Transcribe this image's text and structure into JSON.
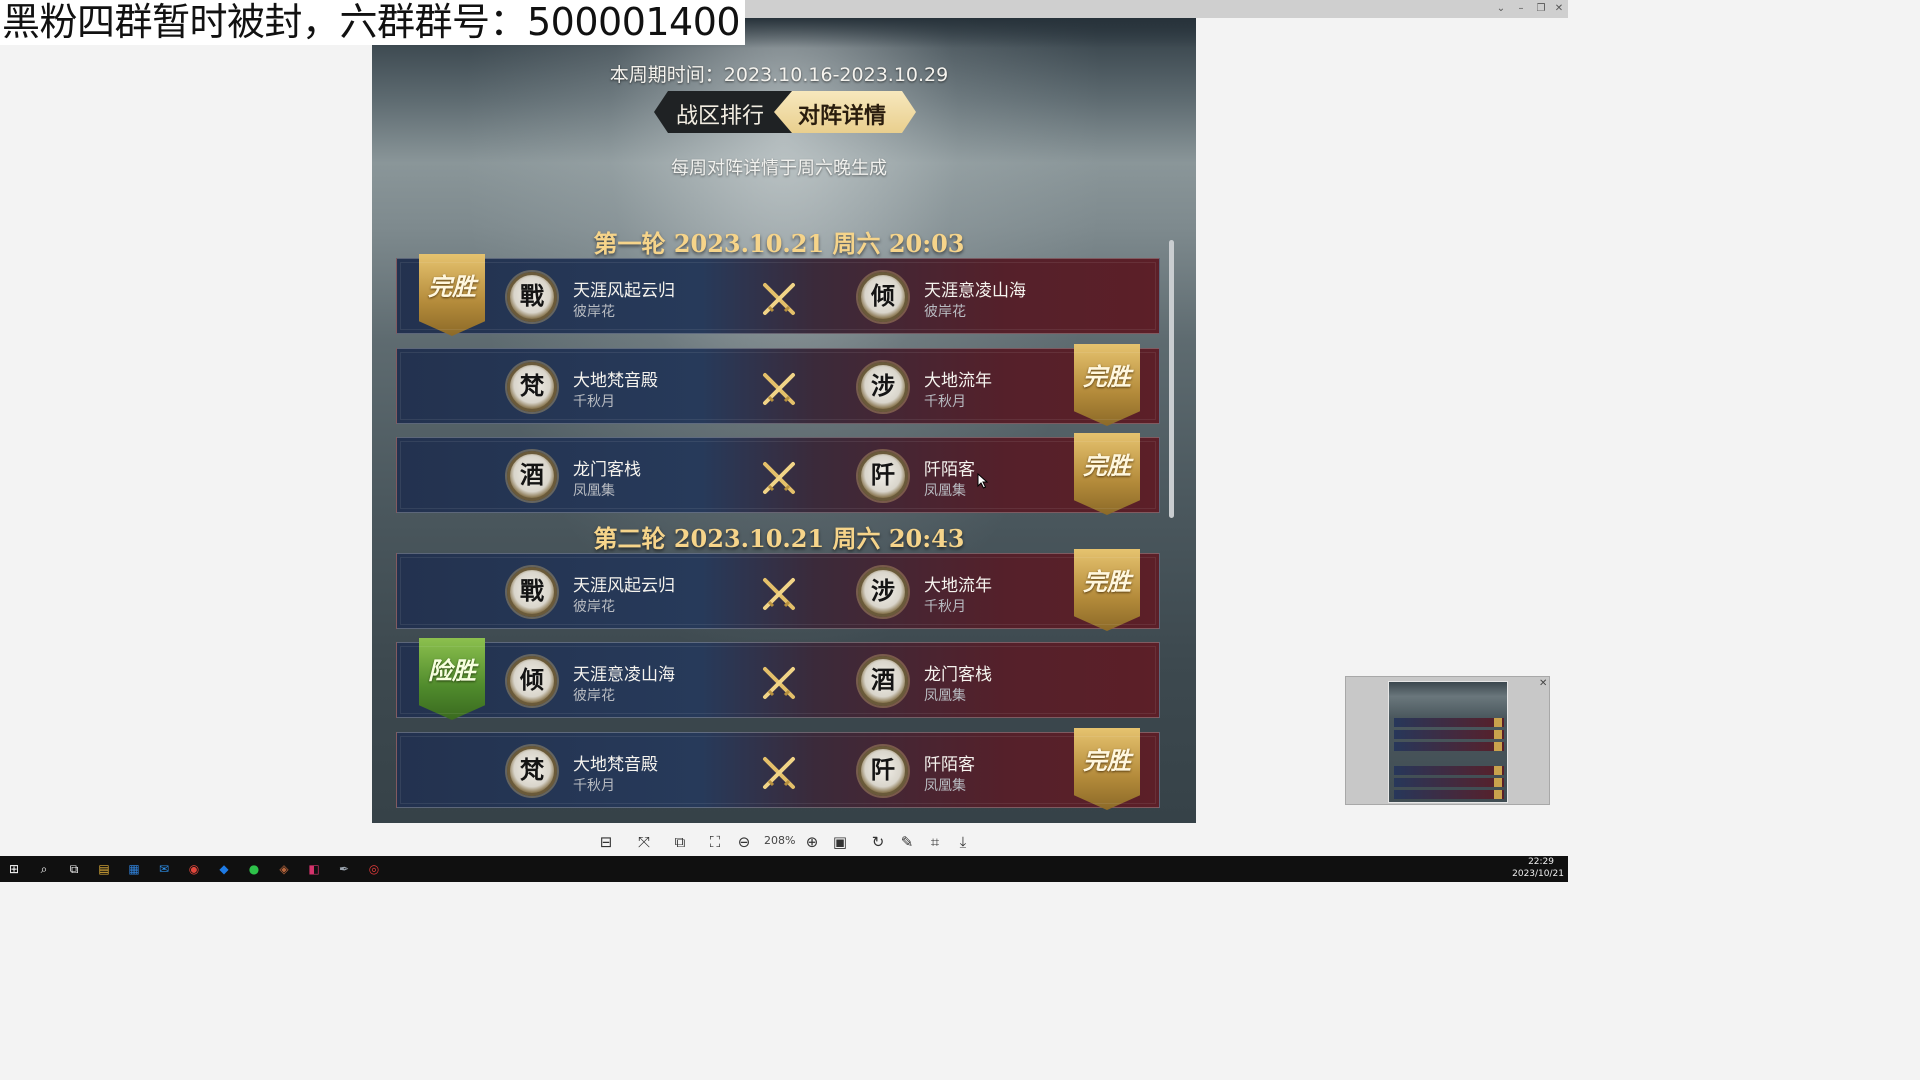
{
  "window": {
    "controls": [
      "⌄",
      "–",
      "❐",
      "✕"
    ]
  },
  "banner": {
    "text": "黑粉四群暂时被封，六群群号：500001400"
  },
  "game": {
    "period": "本周期时间：2023.10.16-2023.10.29",
    "tabs": [
      {
        "label": "战区排行",
        "active": false
      },
      {
        "label": "对阵详情",
        "active": true
      }
    ],
    "notice": "每周对阵详情于周六晚生成",
    "rounds": [
      {
        "title": "第一轮 2023.10.21 周六 20:03",
        "matches": [
          {
            "left": {
              "emblem": "戰",
              "name": "天涯风起云归",
              "server": "彼岸花"
            },
            "right": {
              "emblem": "倾",
              "name": "天涯意凌山海",
              "server": "彼岸花"
            },
            "result": {
              "side": "left",
              "label": "完胜",
              "kind": "win"
            }
          },
          {
            "left": {
              "emblem": "梵",
              "name": "大地梵音殿",
              "server": "千秋月"
            },
            "right": {
              "emblem": "涉",
              "name": "大地流年",
              "server": "千秋月"
            },
            "result": {
              "side": "right",
              "label": "完胜",
              "kind": "win"
            }
          },
          {
            "left": {
              "emblem": "酒",
              "name": "龙门客栈",
              "server": "凤凰集"
            },
            "right": {
              "emblem": "阡",
              "name": "阡陌客",
              "server": "凤凰集"
            },
            "result": {
              "side": "right",
              "label": "完胜",
              "kind": "win"
            }
          }
        ]
      },
      {
        "title": "第二轮 2023.10.21 周六 20:43",
        "matches": [
          {
            "left": {
              "emblem": "戰",
              "name": "天涯风起云归",
              "server": "彼岸花"
            },
            "right": {
              "emblem": "涉",
              "name": "大地流年",
              "server": "千秋月"
            },
            "result": {
              "side": "right",
              "label": "完胜",
              "kind": "win"
            }
          },
          {
            "left": {
              "emblem": "倾",
              "name": "天涯意凌山海",
              "server": "彼岸花"
            },
            "right": {
              "emblem": "酒",
              "name": "龙门客栈",
              "server": "凤凰集"
            },
            "result": {
              "side": "left",
              "label": "险胜",
              "kind": "narrow"
            }
          },
          {
            "left": {
              "emblem": "梵",
              "name": "大地梵音殿",
              "server": "千秋月"
            },
            "right": {
              "emblem": "阡",
              "name": "阡陌客",
              "server": "凤凰集"
            },
            "result": {
              "side": "right",
              "label": "完胜",
              "kind": "win"
            }
          }
        ]
      }
    ]
  },
  "toolbar": {
    "zoom": "208%",
    "buttons": [
      {
        "name": "thumbnail-view-icon",
        "glyph": "⊟"
      },
      {
        "name": "fit-screen-icon",
        "glyph": "⤧"
      },
      {
        "name": "compare-icon",
        "glyph": "⧉"
      },
      {
        "name": "actual-size-icon",
        "glyph": "⛶"
      },
      {
        "name": "zoom-out-icon",
        "glyph": "⊖"
      },
      {
        "name": "zoom-in-icon",
        "glyph": "⊕"
      },
      {
        "name": "one-to-one-icon",
        "glyph": "▣"
      },
      {
        "name": "rotate-icon",
        "glyph": "↻"
      },
      {
        "name": "edit-icon",
        "glyph": "✎"
      },
      {
        "name": "crop-icon",
        "glyph": "⌗"
      },
      {
        "name": "download-icon",
        "glyph": "⤓"
      }
    ]
  },
  "navigator": {
    "close": "✕"
  },
  "taskbar": {
    "time": "22:29",
    "date": "2023/10/21",
    "apps": [
      {
        "name": "start-icon",
        "glyph": "⊞",
        "color": "#ffffff"
      },
      {
        "name": "search-icon",
        "glyph": "⌕",
        "color": "#ffffff"
      },
      {
        "name": "task-view-icon",
        "glyph": "⧉",
        "color": "#ffffff"
      },
      {
        "name": "file-explorer-icon",
        "glyph": "▤",
        "color": "#e8b43a"
      },
      {
        "name": "store-icon",
        "glyph": "▦",
        "color": "#2f7fd6"
      },
      {
        "name": "mail-icon",
        "glyph": "✉",
        "color": "#2d8ee6"
      },
      {
        "name": "chrome-icon",
        "glyph": "◉",
        "color": "#e0463b"
      },
      {
        "name": "app-blue-icon",
        "glyph": "◆",
        "color": "#1e7be6"
      },
      {
        "name": "wechat-icon",
        "glyph": "●",
        "color": "#2ec24a"
      },
      {
        "name": "game-client-icon",
        "glyph": "◈",
        "color": "#b5643b"
      },
      {
        "name": "app-pink-icon",
        "glyph": "◧",
        "color": "#d6336c"
      },
      {
        "name": "app-feather-icon",
        "glyph": "✒",
        "color": "#9aa3ad"
      },
      {
        "name": "app-red-icon",
        "glyph": "◎",
        "color": "#e23b3b"
      }
    ]
  }
}
